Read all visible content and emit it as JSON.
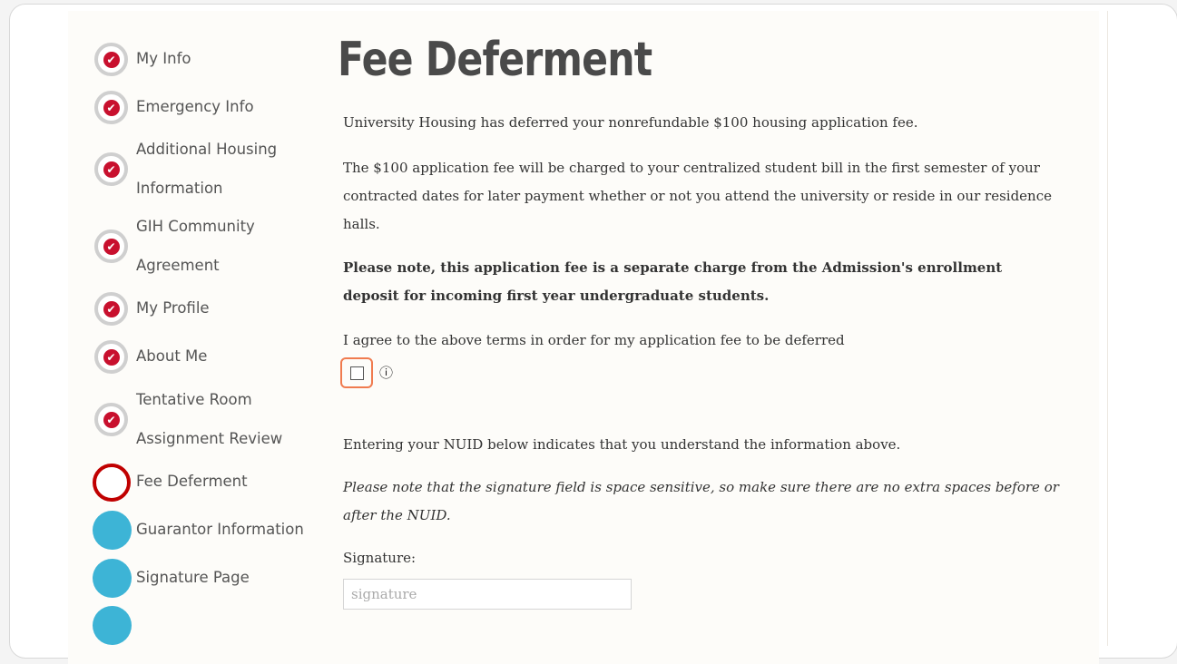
{
  "sidebar": {
    "steps": [
      {
        "lines": [
          "My Info"
        ],
        "status": "done"
      },
      {
        "lines": [
          "Emergency Info"
        ],
        "status": "done"
      },
      {
        "lines": [
          "Additional Housing",
          "Information"
        ],
        "status": "done"
      },
      {
        "lines": [
          "GIH Community",
          "Agreement"
        ],
        "status": "done"
      },
      {
        "lines": [
          "My Profile"
        ],
        "status": "done"
      },
      {
        "lines": [
          "About Me"
        ],
        "status": "done"
      },
      {
        "lines": [
          "Tentative Room",
          "Assignment Review"
        ],
        "status": "done"
      },
      {
        "lines": [
          "Fee Deferment"
        ],
        "status": "current"
      },
      {
        "lines": [
          "Guarantor Information"
        ],
        "status": "future"
      },
      {
        "lines": [
          "Signature Page"
        ],
        "status": "future"
      }
    ],
    "check_glyph": "✔"
  },
  "main": {
    "title": "Fee Deferment",
    "para1": "University Housing has deferred your nonrefundable $100 housing application fee.",
    "para2": "The $100 application fee will be charged to your centralized student bill in the first semester of your contracted dates for later payment whether or not you attend the university or reside in our residence halls.",
    "para3_bold": "Please note, this application fee is a separate charge from the Admission's enrollment deposit for incoming first year undergraduate students.",
    "agree_text": "I agree to the above terms in order for my application fee to be deferred",
    "info_icon": "ⓘ",
    "nuid_text": "Entering your NUID below indicates that you understand the information above.",
    "note_italic": "Please note that the signature field is space sensitive, so make sure there are no extra spaces before or after the NUID.",
    "signature_label": "Signature:",
    "signature_placeholder": "signature",
    "signature_value": ""
  },
  "colors": {
    "done_ring": "#cfcfcf",
    "check": "#c8102e",
    "current_ring": "#c00000",
    "future": "#3db4d6",
    "focus": "#f07b4f"
  }
}
